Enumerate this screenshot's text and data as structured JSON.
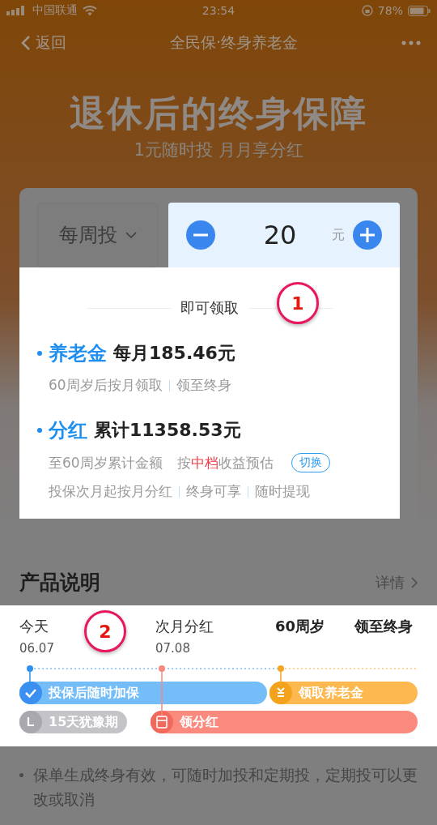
{
  "status_bar": {
    "carrier": "中国联通",
    "time": "23:54",
    "battery": "78%"
  },
  "nav": {
    "back": "返回",
    "title": "全民保·终身养老金"
  },
  "hero": {
    "title": "退休后的终身保障",
    "subtitle": "1元随时投 月月享分红"
  },
  "plan": {
    "frequency": {
      "label": "每周投",
      "highlighted": false
    },
    "amount": {
      "value": "20",
      "unit": "元",
      "highlighted": true
    },
    "benefits": {
      "highlighted": true,
      "step": "1",
      "heading": "即可领取",
      "items": [
        {
          "name": "养老金",
          "amount": "每月185.46元",
          "features": [
            "60周岁后按月领取",
            "领至终身"
          ]
        },
        {
          "name": "分红",
          "amount": "累计11358.53元",
          "basis": "至60周岁累计金额",
          "estimate": {
            "prefix": "按",
            "tier": "中档",
            "suffix": "收益预估"
          },
          "switch": "切换",
          "features": [
            "投保次月起按月分红",
            "终身可享",
            "随时提现"
          ]
        }
      ]
    }
  },
  "product": {
    "title": "产品说明",
    "link": "详情",
    "highlighted": false
  },
  "timeline": {
    "highlighted": true,
    "step": "2",
    "milestones": [
      {
        "label": "今天",
        "date": "06.07",
        "color": "#2e8fef"
      },
      {
        "label": "次月分红",
        "date": "07.08",
        "color": "#f58a80"
      },
      {
        "label": "60周岁",
        "color": "#f5a623"
      },
      {
        "label": "领至终身"
      }
    ],
    "bars": [
      {
        "label": "投保后随时加保",
        "kind": "check",
        "color": "#74bdf8"
      },
      {
        "label": "领取养老金",
        "kind": "yen",
        "color": "#fdb94f"
      },
      {
        "label": "15天犹豫期",
        "kind": "clock",
        "color": "#c4c3c8"
      },
      {
        "label": "领分红",
        "kind": "packet",
        "color": "#fb8a7e"
      }
    ]
  },
  "notes": {
    "highlighted": false,
    "items": [
      "保单生成终身有效，可随时加投和定期投，定期投可以更改或取消"
    ]
  }
}
